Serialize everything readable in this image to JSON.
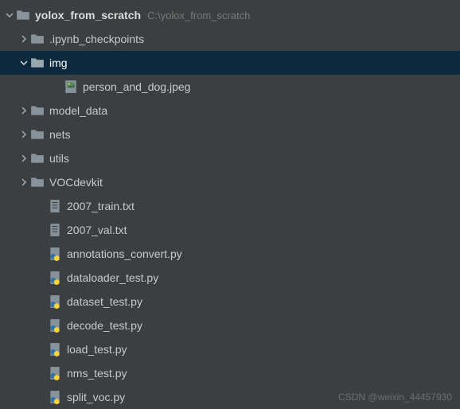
{
  "root": {
    "name": "yolox_from_scratch",
    "path": "C:\\yolox_from_scratch"
  },
  "folders": {
    "checkpoints": ".ipynb_checkpoints",
    "img": "img",
    "model_data": "model_data",
    "nets": "nets",
    "utils": "utils",
    "vocdevkit": "VOCdevkit"
  },
  "img_children": {
    "person_dog": "person_and_dog.jpeg"
  },
  "files": {
    "train": "2007_train.txt",
    "val": "2007_val.txt",
    "ann": "annotations_convert.py",
    "dataloader": "dataloader_test.py",
    "dataset": "dataset_test.py",
    "decode": "decode_test.py",
    "load": "load_test.py",
    "nms": "nms_test.py",
    "split": "split_voc.py"
  },
  "watermark": "CSDN @weixin_44457930"
}
